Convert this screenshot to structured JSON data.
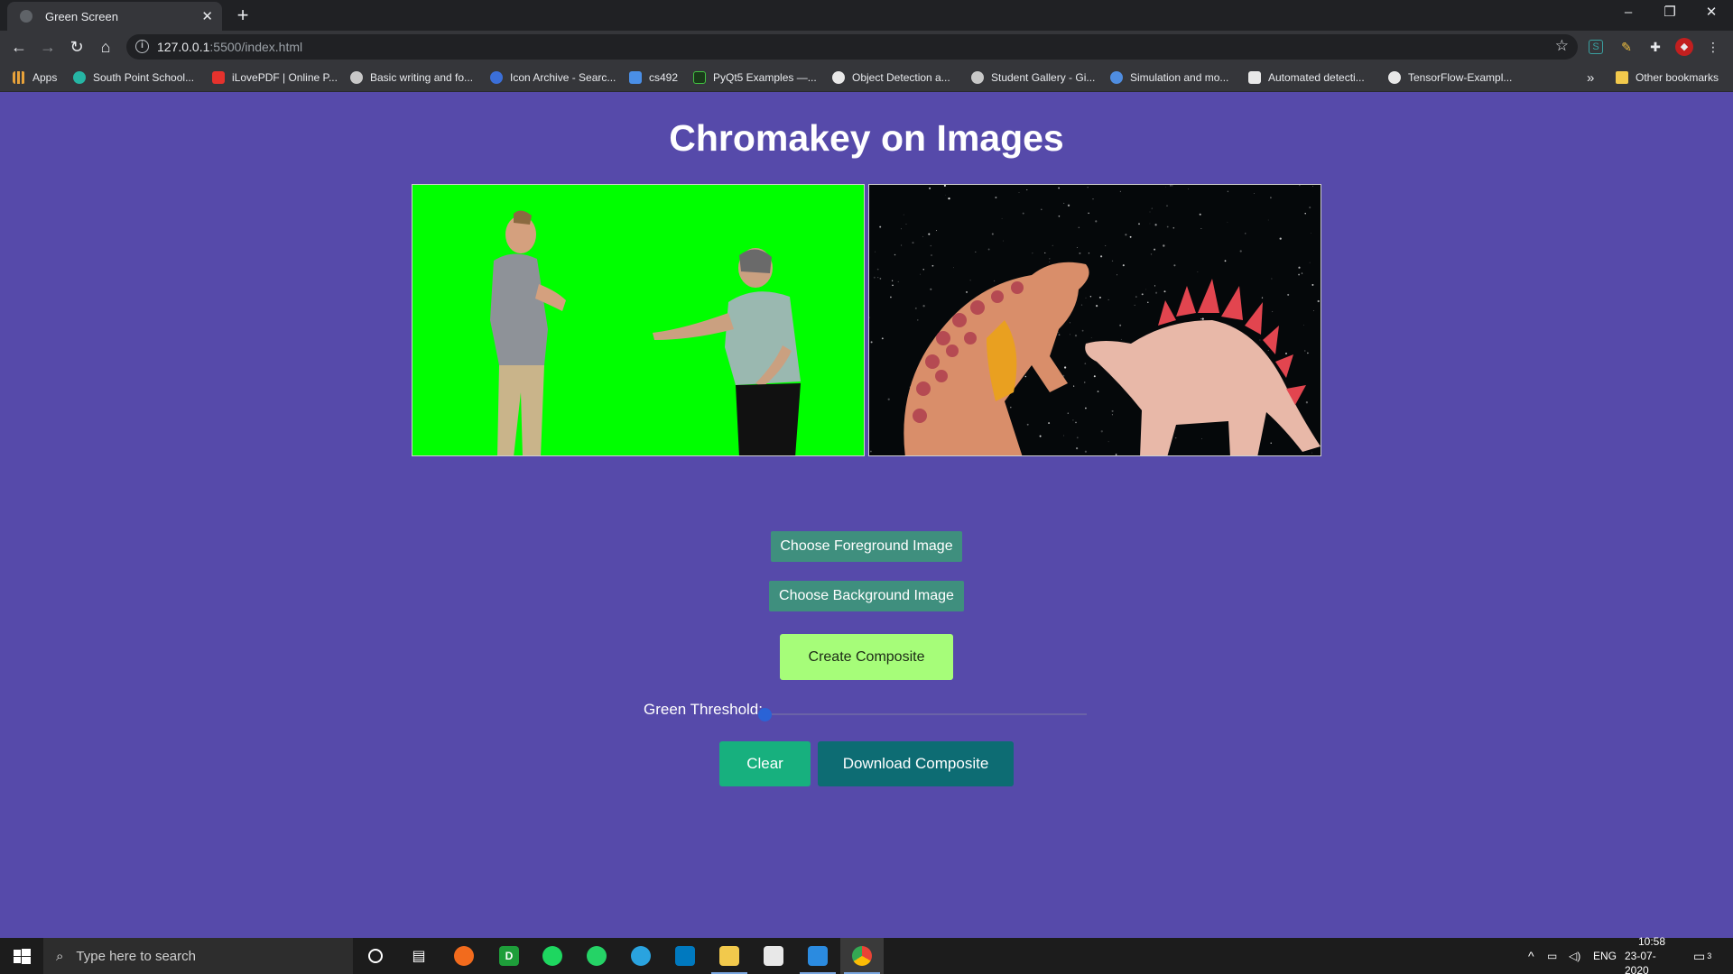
{
  "browser": {
    "tab_title": "Green Screen",
    "url_host": "127.0.0.1",
    "url_rest": ":5500/index.html",
    "bookmarks": [
      {
        "label": "Apps",
        "color": "#e8a23a"
      },
      {
        "label": "South Point School...",
        "color": "#26b5a4"
      },
      {
        "label": "iLovePDF | Online P...",
        "color": "#e5322d"
      },
      {
        "label": "Basic writing and fo...",
        "color": "#c8c8c8"
      },
      {
        "label": "Icon Archive - Searc...",
        "color": "#3b6fd8"
      },
      {
        "label": "cs492",
        "color": "#4a8fe7"
      },
      {
        "label": "PyQt5 Examples —...",
        "color": "#41c341"
      },
      {
        "label": "Object Detection a...",
        "color": "#e8e8e8"
      },
      {
        "label": "Student Gallery - Gi...",
        "color": "#c8c8c8"
      },
      {
        "label": "Simulation and mo...",
        "color": "#4f8de0"
      },
      {
        "label": "Automated detecti...",
        "color": "#e8e8e8"
      },
      {
        "label": "TensorFlow-Exampl...",
        "color": "#e8e8e8"
      }
    ],
    "overflow_label": "»",
    "other_bookmarks": "Other bookmarks"
  },
  "page": {
    "title": "Chromakey on Images",
    "choose_fg": "Choose Foreground Image",
    "choose_bg": "Choose Background Image",
    "create": "Create Composite",
    "threshold_label": "Green Threshold:",
    "threshold_value": 0,
    "clear": "Clear",
    "download": "Download Composite"
  },
  "taskbar": {
    "search_placeholder": "Type here to search",
    "lang": "ENG",
    "time": "10:58",
    "date": "23-07-2020",
    "notifications": "3"
  }
}
